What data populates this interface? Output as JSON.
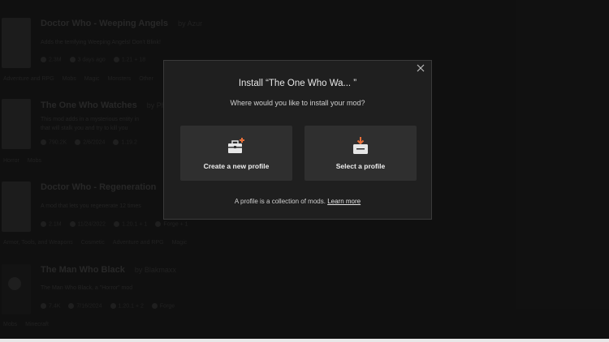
{
  "background_list": {
    "mods": [
      {
        "title": "Doctor Who - Weeping Angels",
        "author": "by Azur",
        "description": "Adds the terrifying Weeping Angels! Don't Blink!",
        "stats": [
          "2.3M",
          "3 days ago",
          "1.21 + 18"
        ],
        "tags": [
          "Adventure and RPG",
          "Mobs",
          "Magic",
          "Monsters",
          "Other"
        ]
      },
      {
        "title": "The One Who Watches",
        "author": "by Ph",
        "description": "This mod adds in a mysterious entity in",
        "description2": "that will stalk you and try to kill you",
        "stats": [
          "790.2K",
          "2/6/2024",
          "1.19.2"
        ],
        "tags": [
          "Horror",
          "Mobs"
        ]
      },
      {
        "title": "Doctor Who - Regeneration",
        "author": "",
        "description": "A mod that lets you regenerate 12 times",
        "stats": [
          "2.1M",
          "11/24/2022",
          "1.20.1 + 1",
          "Forge + 1"
        ],
        "tags": [
          "Armor, Tools, and Weapons",
          "Cosmetic",
          "Adventure and RPG",
          "Magic"
        ]
      },
      {
        "title": "The Man Who Black",
        "author": "by Blakmaxx",
        "description": "The Man Who Black, a \"Horror\" mod",
        "stats": [
          "7.4K",
          "7/16/2024",
          "1.20.1 + 2",
          "Forge"
        ],
        "tags": [
          "Mobs",
          "Minecraft"
        ]
      }
    ]
  },
  "modal": {
    "title": "Install “The One Who Wa... ”",
    "subtitle": "Where would you like to install your mod?",
    "close_icon": "close-icon",
    "options": [
      {
        "label": "Create a new profile",
        "icon": "briefcase-plus-icon",
        "accent": "#e8703a"
      },
      {
        "label": "Select a profile",
        "icon": "import-arrow-icon",
        "accent": "#e8703a"
      }
    ],
    "footer_text": "A profile is a collection of mods.",
    "learn_more": "Learn more"
  },
  "colors": {
    "accent": "#e8703a",
    "modal_bg": "#1f1f1f",
    "card_bg": "#2f2f2f",
    "backdrop": "#1a1a1a"
  }
}
